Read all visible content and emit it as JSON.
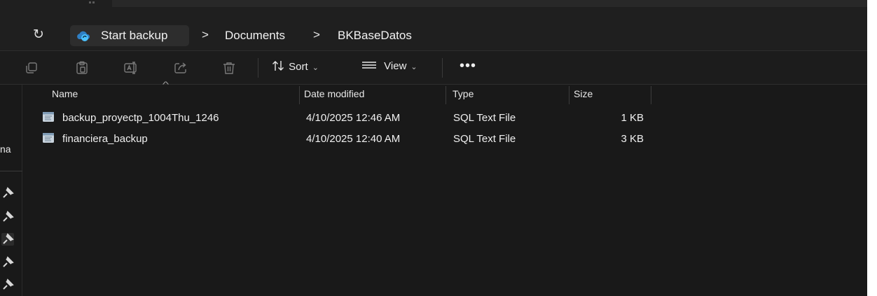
{
  "breadcrumb": {
    "items": [
      "Start backup",
      "Documents",
      "BKBaseDatos"
    ],
    "separator": ">"
  },
  "toolbar": {
    "sort_label": "Sort",
    "view_label": "View",
    "more_label": "•••"
  },
  "nav": {
    "partial_label": "na"
  },
  "list": {
    "columns": [
      "Name",
      "Date modified",
      "Type",
      "Size"
    ],
    "files": [
      {
        "name": "backup_proyectp_1004Thu_1246",
        "date": "4/10/2025 12:46 AM",
        "type": "SQL Text File",
        "size": "1 KB"
      },
      {
        "name": "financiera_backup",
        "date": "4/10/2025 12:40 AM",
        "type": "SQL Text File",
        "size": "3 KB"
      }
    ]
  },
  "icons": {
    "refresh": "refresh-icon",
    "root": "cloud-sync-icon",
    "copy": "copy-icon",
    "paste": "paste-icon",
    "rename": "rename-icon",
    "share": "share-icon",
    "delete": "delete-icon",
    "sort": "sort-arrows-icon",
    "view": "view-lines-icon",
    "file": "sql-file-icon",
    "pin": "pin-icon"
  },
  "colors": {
    "background": "#191919",
    "accent": "#4cc2ff",
    "text": "#f0f0f0"
  }
}
